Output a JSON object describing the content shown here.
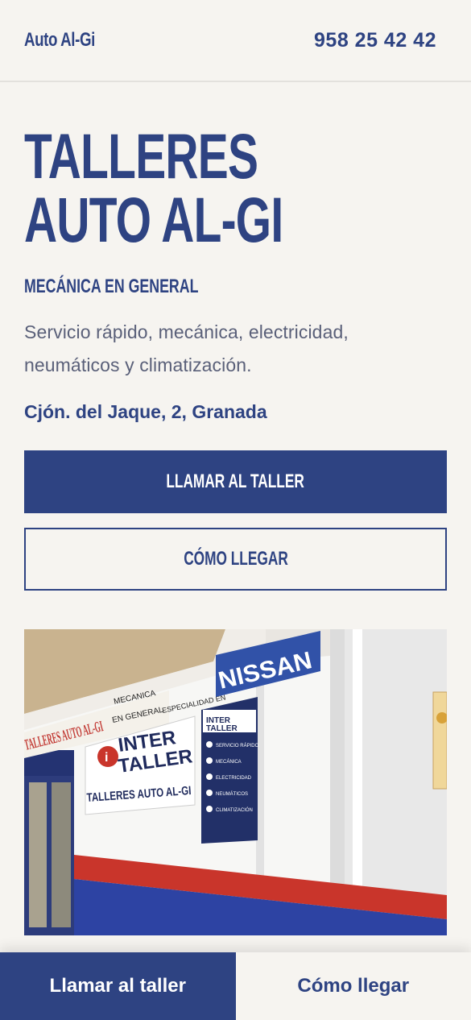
{
  "header": {
    "brand": "Auto Al-Gi",
    "phone": "958 25 42 42"
  },
  "hero": {
    "title_line1": "TALLERES",
    "title_line2": "AUTO AL-GI",
    "subtitle": "MECÁNICA EN GENERAL",
    "description": "Servicio rápido, mecánica, electricidad, neumáticos y climatización.",
    "address": "Cjón. del Jaque, 2, Granada"
  },
  "buttons": {
    "call_label": "LLAMAR AL TALLER",
    "directions_label": "CÓMO LLEGAR"
  },
  "photo": {
    "sign_nissan": "NISSAN",
    "sign_mecanica": "MECANICA",
    "sign_en_general": "EN GENERAL",
    "sign_especialidad": "ESPECIALIDAD EN",
    "sign_talleres_facade": "TALLERES AUTO AL-GI",
    "sign_inter": "INTER",
    "sign_taller": "TALLER",
    "sign_board_name": "TALLERES AUTO AL-GI",
    "panel_items": [
      "SERVICIO RÁPIDO",
      "MECÁNICA",
      "ELECTRICIDAD",
      "NEUMÁTICOS",
      "CLIMATIZACIÓN"
    ]
  },
  "bottom_bar": {
    "call_label": "Llamar al taller",
    "directions_label": "Cómo llegar"
  },
  "colors": {
    "primary": "#2e4382",
    "background": "#f6f4f0",
    "text_muted": "#5a6079",
    "stripe_red": "#c9352b"
  }
}
